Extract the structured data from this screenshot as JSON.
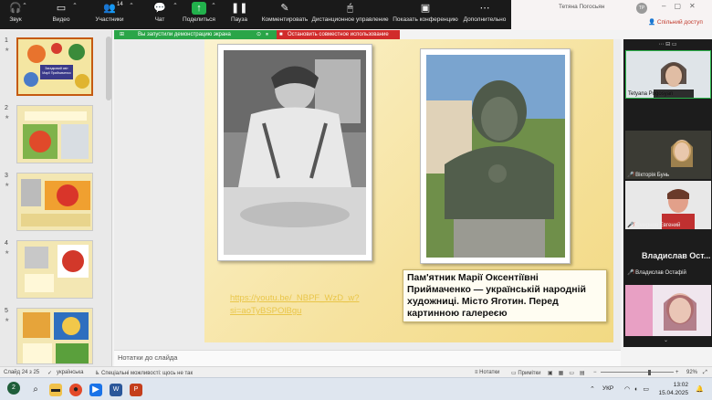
{
  "toolbar": {
    "sound": "Звук",
    "video": "Видео",
    "participants": "Участники",
    "participants_count": "14",
    "chat": "Чат",
    "share": "Поделиться",
    "pause": "Пауза",
    "comment": "Комментировать",
    "remote": "Дистанционное управление",
    "show_conf": "Показать конференцию",
    "more": "Дополнительно"
  },
  "office": {
    "user": "Тетяна Погосьян",
    "avatar_initials": "TP",
    "share_access": "Спільний доступ"
  },
  "banners": {
    "demo": "Вы запустили демонстрацию экрана",
    "stop": "Остановить совместное использование"
  },
  "slides_panel": {
    "numbers": [
      "1",
      "2",
      "3",
      "4",
      "5"
    ],
    "thumb1_title": "Загадковий світ Марії Приймаченко"
  },
  "slide": {
    "caption": "Пам'ятник Марії Оксентіївні Приймаченко — українській народній художниці. Місто Яготин. Перед картинною галереєю",
    "link": "https://youtu.be/_NBPF_WzD_w?si=aoTyBSPOlBgu"
  },
  "notes_placeholder": "Нотатки до слайда",
  "participants": [
    {
      "name": "Tetyana Pogosyan",
      "muted": false
    },
    {
      "name": "Вікторія Бунь",
      "muted": true
    },
    {
      "name": "Смирнов Евгений",
      "muted": true
    },
    {
      "name": "Владислав Ост...",
      "muted": false
    },
    {
      "name": "Владислав Остафій",
      "muted": true
    }
  ],
  "statusbar": {
    "slide_info": "Слайд 24 з 25",
    "language": "українська",
    "accessibility": "Спеціальні можливості: щось не так",
    "notes": "Нотатки",
    "comments": "Примітки",
    "zoom": "92%"
  },
  "taskbar": {
    "lang": "УКР",
    "time": "13:02",
    "date": "15.04.2025",
    "weather": "2"
  },
  "colors": {
    "zoom_bar": "#1a1a1a",
    "share_green": "#22b14c",
    "stop_red": "#d12b2b",
    "accent_orange": "#c55a11"
  }
}
